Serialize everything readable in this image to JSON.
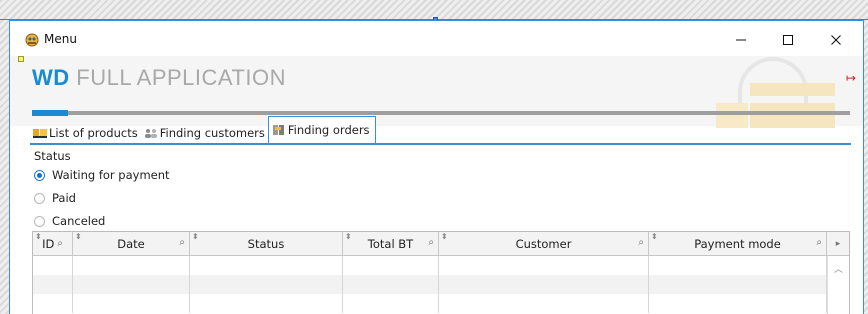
{
  "window": {
    "title": "Menu",
    "minimize_label": "—",
    "maximize_label": "☐",
    "close_label": "✕"
  },
  "banner": {
    "brand_bold": "WD",
    "brand_rest": " FULL APPLICATION",
    "logout_icon_glyph": "↦"
  },
  "tabs": [
    {
      "label": "List of products",
      "icon": "products-icon",
      "active": false
    },
    {
      "label": "Finding customers",
      "icon": "customers-icon",
      "active": false
    },
    {
      "label": "Finding orders",
      "icon": "orders-icon",
      "active": true
    }
  ],
  "status": {
    "label": "Status",
    "options": [
      {
        "label": "Waiting for payment",
        "checked": true
      },
      {
        "label": "Paid",
        "checked": false
      },
      {
        "label": "Canceled",
        "checked": false
      }
    ]
  },
  "table": {
    "columns": [
      "ID",
      "Date",
      "Status",
      "Total BT",
      "Customer",
      "Payment mode"
    ],
    "rows": 3
  },
  "colors": {
    "accent": "#1a8bd2",
    "window_border": "#3c8ed4",
    "logout": "#c2252c"
  }
}
